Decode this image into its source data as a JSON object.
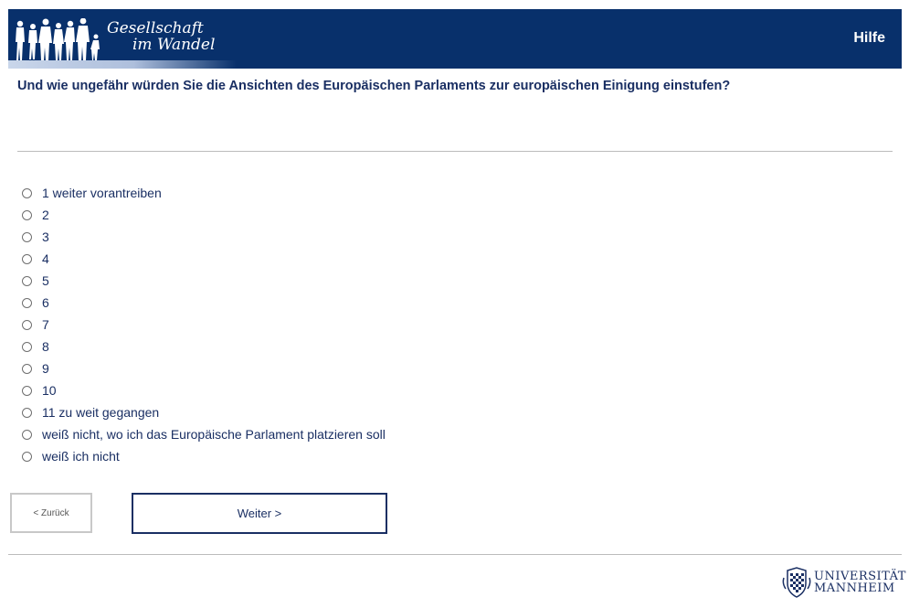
{
  "header": {
    "logo_line1": "Gesellschaft",
    "logo_line2": "im Wandel",
    "help_label": "Hilfe",
    "background_color": "#08306b"
  },
  "question": "Und wie ungefähr würden Sie die Ansichten des Europäischen Parlaments zur europäischen Einigung einstufen?",
  "options": [
    "1 weiter vorantreiben",
    "2",
    "3",
    "4",
    "5",
    "6",
    "7",
    "8",
    "9",
    "10",
    "11 zu weit gegangen",
    "weiß nicht, wo ich das Europäische Parlament platzieren soll",
    "weiß ich nicht"
  ],
  "nav": {
    "back_label": "< Zurück",
    "next_label": "Weiter >"
  },
  "footer": {
    "logo_line1": "UNIVERSITÄT",
    "logo_line2": "MANNHEIM"
  }
}
